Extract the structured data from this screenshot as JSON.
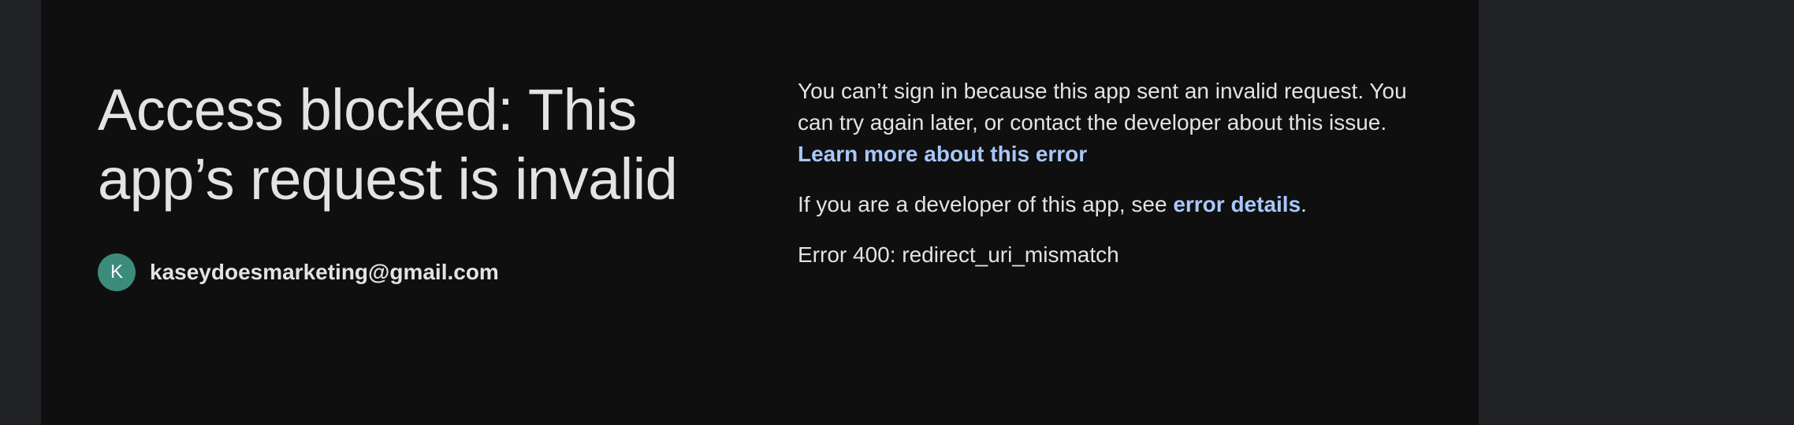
{
  "headline": "Access blocked: This app’s request is invalid",
  "account": {
    "avatar_initial": "K",
    "email": "kaseydoesmarketing@gmail.com"
  },
  "message": {
    "body": "You can’t sign in because this app sent an invalid request. You can try again later, or contact the developer about this issue.",
    "learn_more_link": "Learn more about this error",
    "developer_prefix": "If you are a developer of this app, see ",
    "error_details_link": "error details",
    "developer_suffix": ".",
    "error_code": "Error 400: redirect_uri_mismatch"
  },
  "colors": {
    "background": "#0f0f0f",
    "text": "#e3e3e3",
    "link": "#a8c7fa",
    "avatar": "#3d8b7d"
  }
}
